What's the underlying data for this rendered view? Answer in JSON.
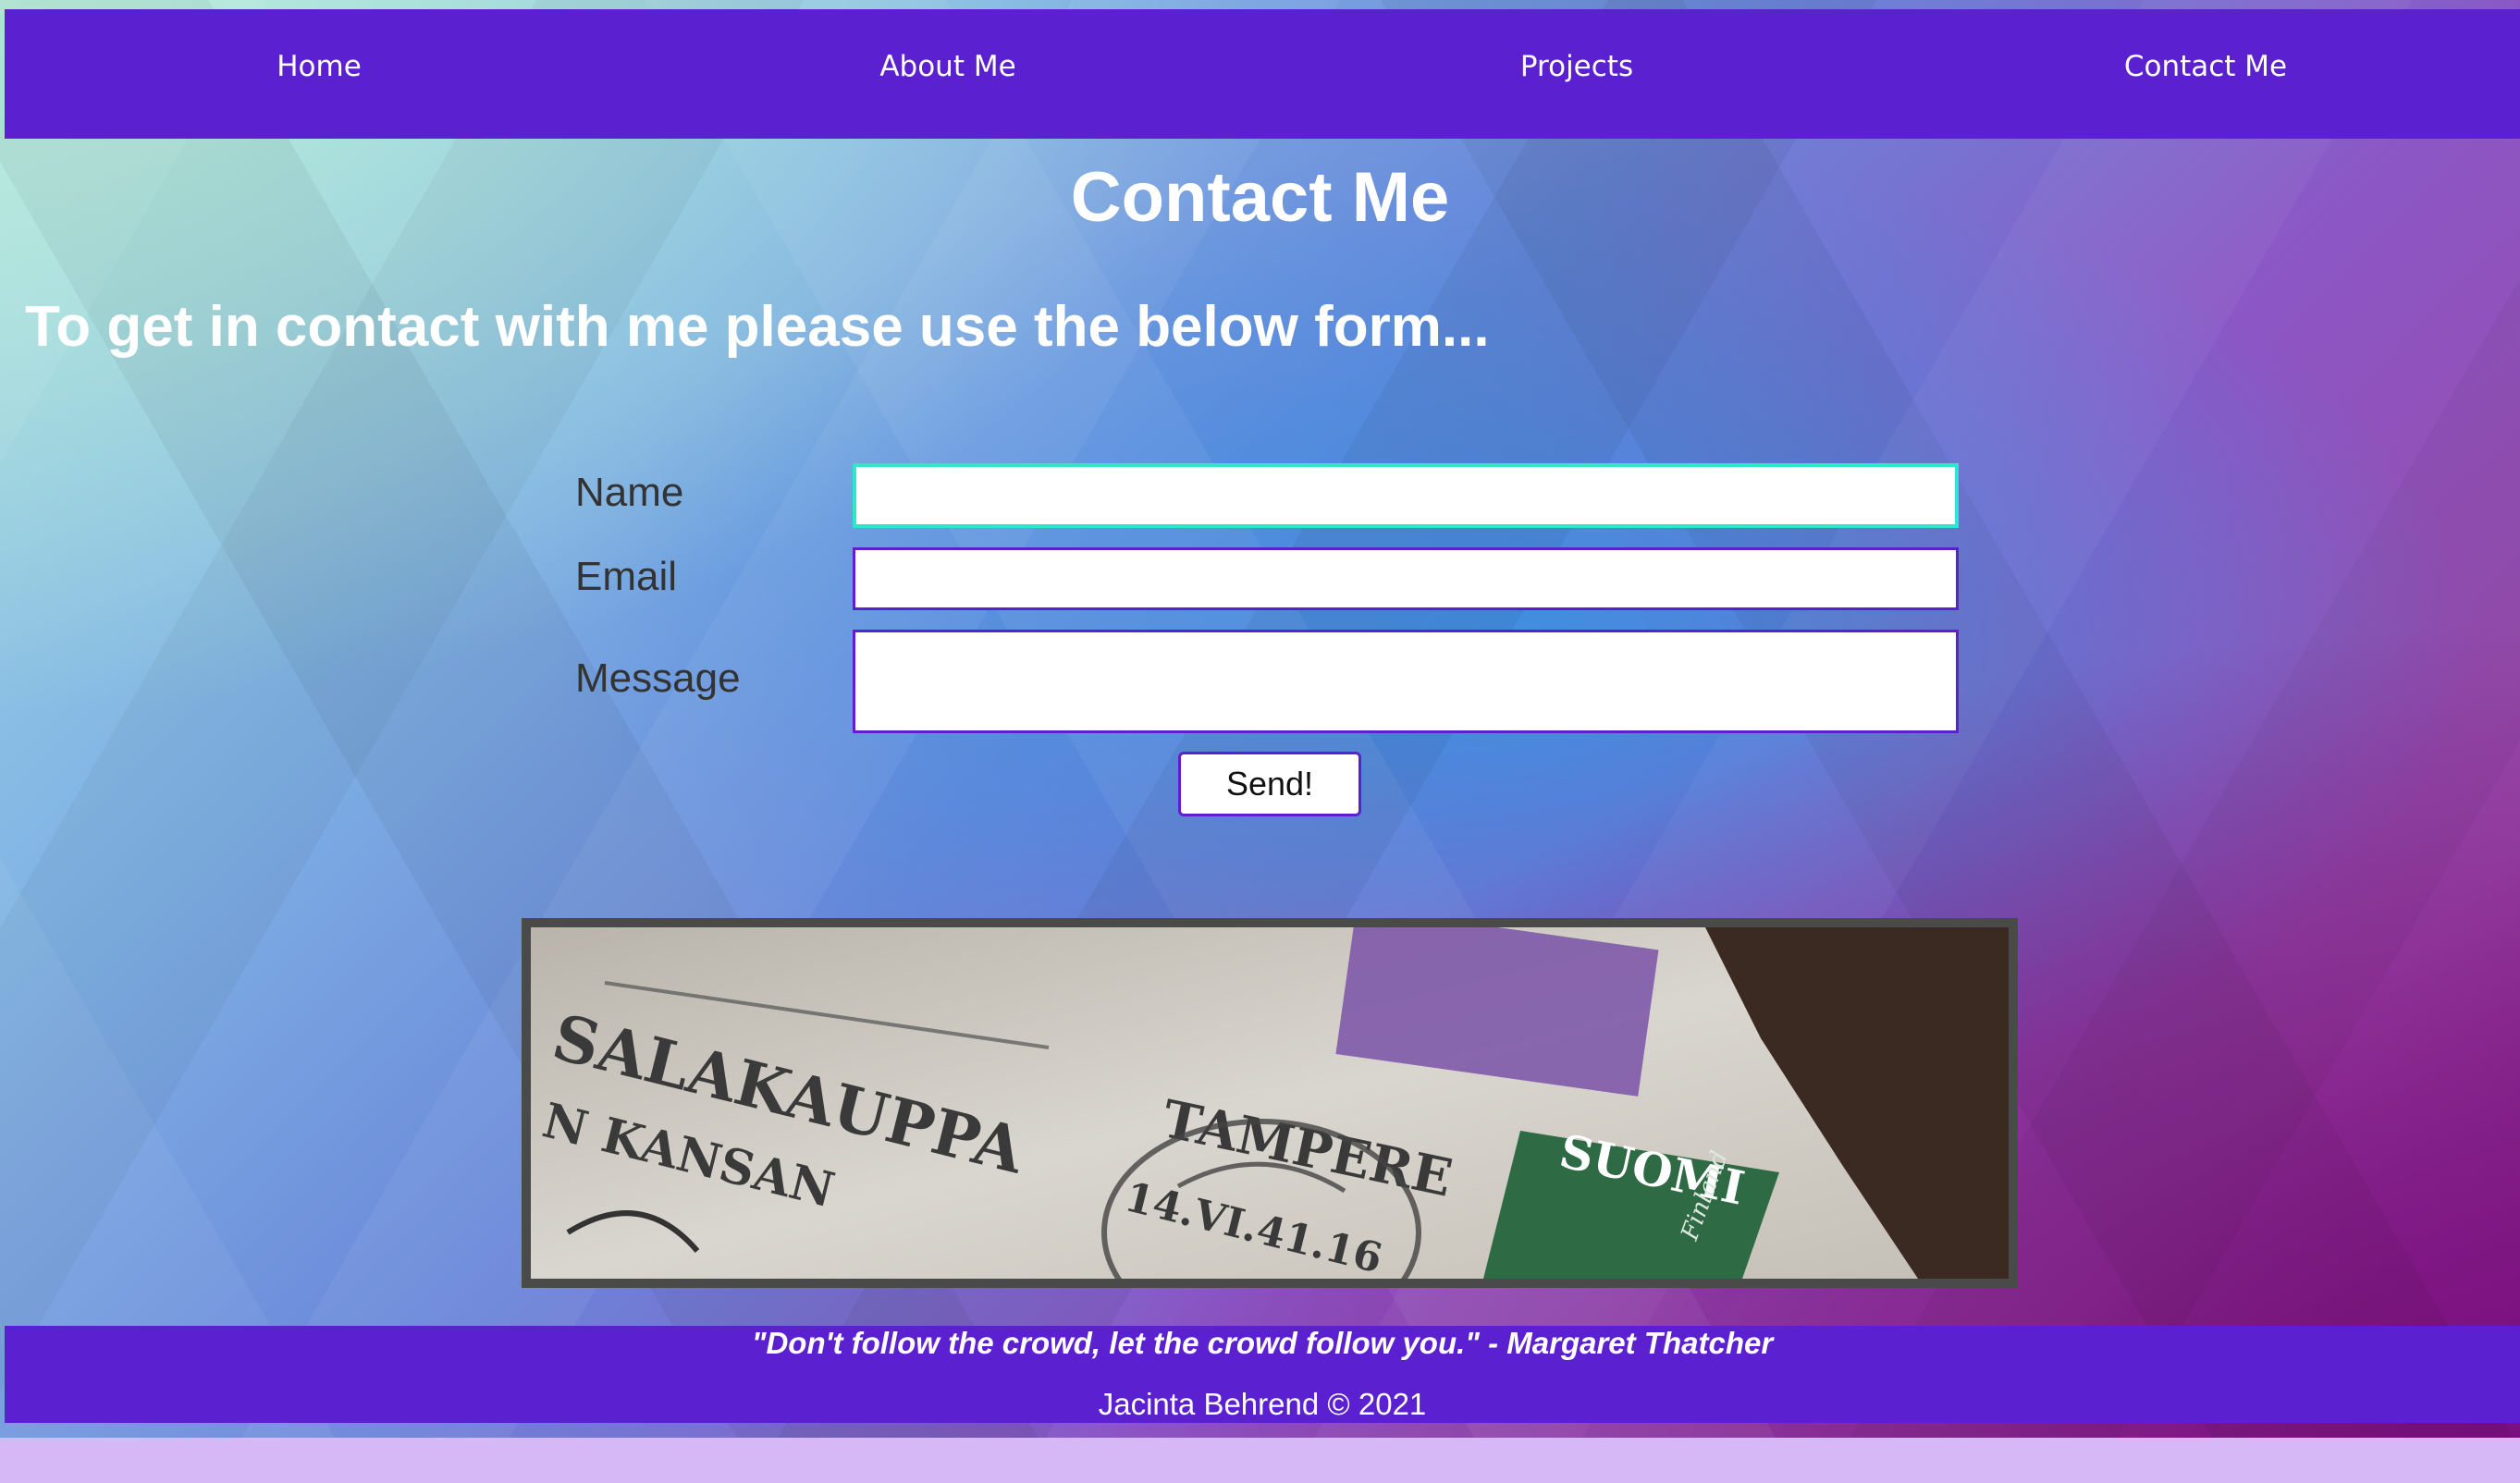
{
  "nav": {
    "items": [
      "Home",
      "About Me",
      "Projects",
      "Contact Me"
    ]
  },
  "page": {
    "title": "Contact Me",
    "intro": "To get in contact with me please use the below form..."
  },
  "form": {
    "name_label": "Name",
    "email_label": "Email",
    "message_label": "Message",
    "name_value": "",
    "email_value": "",
    "message_value": "",
    "send_label": "Send!"
  },
  "photo": {
    "postmark_text_1": "SALAKAUPPA",
    "postmark_text_2": "N KANSAN",
    "postmark_city": "TAMPERE",
    "postmark_date": "14.VI.41.16",
    "stamp_text": "SUOMI",
    "stamp_subtext": "Finland"
  },
  "footer": {
    "quote": "\"Don't follow the crowd, let the crowd follow you.\" - Margaret Thatcher",
    "copyright": "Jacinta Behrend © 2021"
  },
  "colors": {
    "nav_bg": "#5b21d1",
    "focus_border": "#2ee6c8",
    "field_border": "#5b21d1"
  }
}
